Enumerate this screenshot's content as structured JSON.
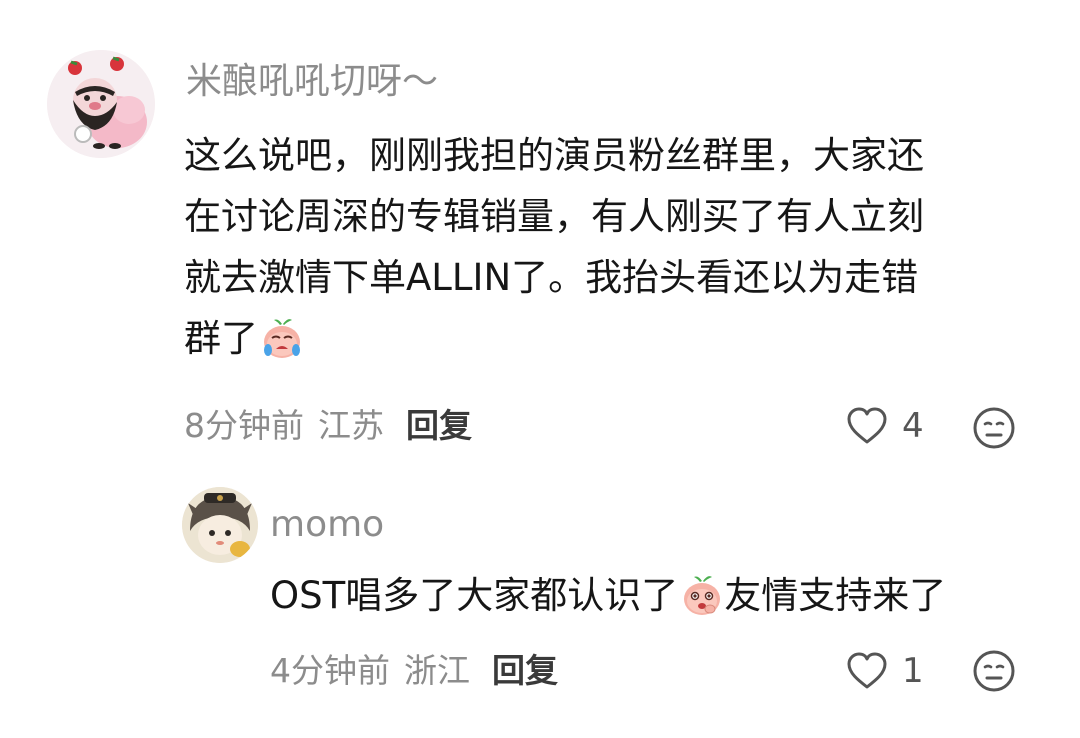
{
  "comments": [
    {
      "username": "米酿吼吼切呀～",
      "lines": [
        "这么说吧，刚刚我担的演员粉丝群里，大家还",
        "在讨论周深的专辑销量，有人刚买了有人立刻",
        "就去激情下单ALLIN了。我抬头看还以为走错",
        "群了"
      ],
      "emoji": "crying-peach-emoji",
      "time": "8分钟前",
      "location": "江苏",
      "reply_label": "回复",
      "likes": "4"
    },
    {
      "username": "momo",
      "text_before_emoji": "OST唱多了大家都认识了",
      "emoji": "shy-peach-emoji",
      "text_after_emoji": "友情支持来了",
      "time": "4分钟前",
      "location": "浙江",
      "reply_label": "回复",
      "likes": "1"
    }
  ],
  "icons": {
    "like": "heart-outline-icon",
    "more": "meh-face-icon"
  }
}
